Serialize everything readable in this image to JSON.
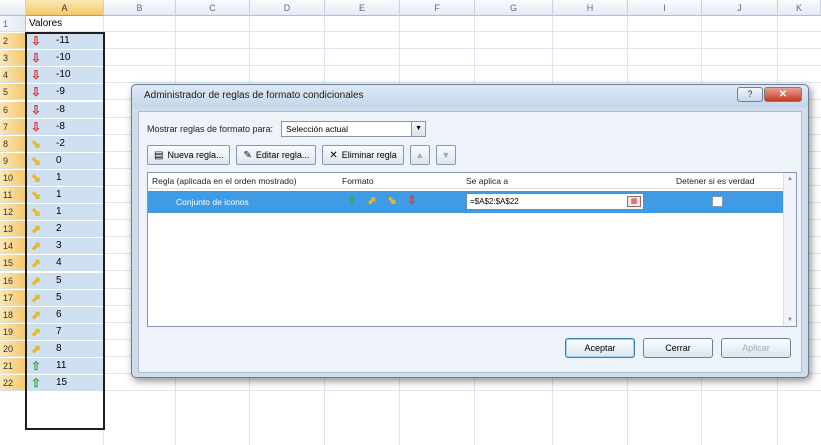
{
  "spreadsheet": {
    "columns": [
      "A",
      "B",
      "C",
      "D",
      "E",
      "F",
      "G",
      "H",
      "I",
      "J",
      "K"
    ],
    "row_numbers": [
      "1",
      "2",
      "3",
      "4",
      "5",
      "6",
      "7",
      "8",
      "9",
      "10",
      "11",
      "12",
      "13",
      "14",
      "15",
      "16",
      "17",
      "18",
      "19",
      "20",
      "21",
      "22"
    ],
    "header_cell": "Valores",
    "rows": [
      {
        "icon": "red-down-arrow-icon",
        "value": "-11"
      },
      {
        "icon": "red-down-arrow-icon",
        "value": "-10"
      },
      {
        "icon": "red-down-arrow-icon",
        "value": "-10"
      },
      {
        "icon": "red-down-arrow-icon",
        "value": "-9"
      },
      {
        "icon": "red-down-arrow-icon",
        "value": "-8"
      },
      {
        "icon": "red-down-arrow-icon",
        "value": "-8"
      },
      {
        "icon": "yellow-down-right-arrow-icon",
        "value": "-2"
      },
      {
        "icon": "yellow-down-right-arrow-icon",
        "value": "0"
      },
      {
        "icon": "yellow-down-right-arrow-icon",
        "value": "1"
      },
      {
        "icon": "yellow-down-right-arrow-icon",
        "value": "1"
      },
      {
        "icon": "yellow-down-right-arrow-icon",
        "value": "1"
      },
      {
        "icon": "yellow-up-right-arrow-icon",
        "value": "2"
      },
      {
        "icon": "yellow-up-right-arrow-icon",
        "value": "3"
      },
      {
        "icon": "yellow-up-right-arrow-icon",
        "value": "4"
      },
      {
        "icon": "yellow-up-right-arrow-icon",
        "value": "5"
      },
      {
        "icon": "yellow-up-right-arrow-icon",
        "value": "5"
      },
      {
        "icon": "yellow-up-right-arrow-icon",
        "value": "6"
      },
      {
        "icon": "yellow-up-right-arrow-icon",
        "value": "7"
      },
      {
        "icon": "yellow-up-right-arrow-icon",
        "value": "8"
      },
      {
        "icon": "green-up-arrow-icon",
        "value": "11"
      },
      {
        "icon": "green-up-arrow-icon",
        "value": "15"
      }
    ],
    "colors": {
      "selection_fill": "#cfe0f3",
      "red_arrow": "#d9352a",
      "yellow_arrow": "#e9b825",
      "green_arrow": "#3aa93a"
    }
  },
  "dialog": {
    "title": "Administrador de reglas de formato condicionales",
    "show_rules_label": "Mostrar reglas de formato para:",
    "scope_value": "Selección actual",
    "buttons": {
      "new_rule": "Nueva regla...",
      "edit_rule": "Editar regla...",
      "delete_rule": "Eliminar regla"
    },
    "columns": {
      "rule": "Regla (aplicada en el orden mostrado)",
      "format": "Formato",
      "applies_to": "Se aplica a",
      "stop_if_true": "Detener si es verdad"
    },
    "rule_row": {
      "name": "Conjunto de iconos",
      "applies_to": "=$A$2:$A$22",
      "stop_if_true": false
    },
    "footer": {
      "ok": "Aceptar",
      "close": "Cerrar",
      "apply": "Aplicar"
    },
    "accent": "#3f9be4"
  }
}
